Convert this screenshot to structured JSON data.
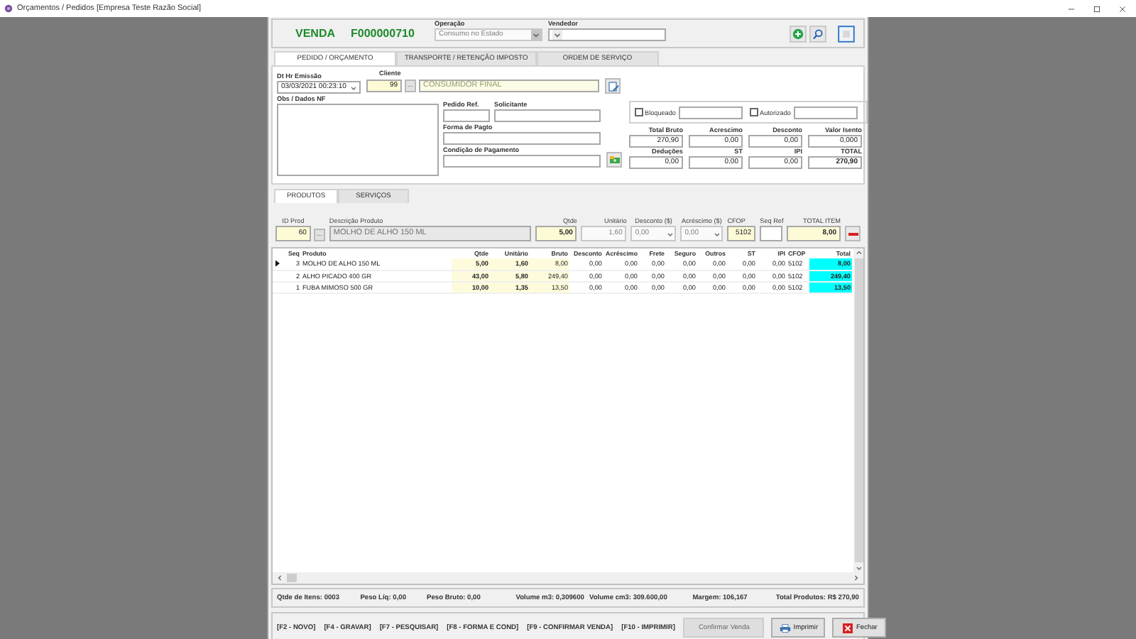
{
  "window": {
    "title": "Orçamentos / Pedidos [Empresa Teste Razão Social]"
  },
  "header": {
    "type": "VENDA",
    "number": "F000000710",
    "operation": {
      "label": "Operação",
      "value": "Consumo no Estado",
      "disabled": true
    },
    "seller": {
      "label": "Vendedor"
    }
  },
  "tabs": [
    {
      "label": "PEDIDO / ORÇAMENTO",
      "selected": true
    },
    {
      "label": "TRANSPORTE / RETENÇÃO IMPOSTO",
      "selected": false
    },
    {
      "label": "ORDEM DE SERVIÇO",
      "selected": false
    }
  ],
  "order": {
    "emission": {
      "label": "Dt Hr Emissão",
      "value": "03/03/2021 00:23:10"
    },
    "customer": {
      "label": "Cliente",
      "id": "99",
      "button": "...",
      "name": "CONSUMIDOR FINAL"
    },
    "notes": {
      "label": "Obs / Dados NF"
    },
    "reference": {
      "label": "Pedido Ref."
    },
    "requester": {
      "label": "Solicitante"
    },
    "payment_form": {
      "label": "Forma de Pagto"
    },
    "payment_terms": {
      "label": "Condição de Pagamento"
    },
    "flags": [
      {
        "label": "Bloqueado",
        "checked": false
      },
      {
        "label": "Autorizado",
        "checked": false
      }
    ],
    "totals": [
      {
        "label": "Total Bruto",
        "value": "270,90",
        "bold": false
      },
      {
        "label": "Acrescimo",
        "value": "0,00",
        "bold": false
      },
      {
        "label": "Desconto",
        "value": "0,00",
        "bold": false
      },
      {
        "label": "Valor Isento",
        "value": "0,000",
        "bold": false
      },
      {
        "label": "Deduções",
        "value": "0,00",
        "bold": false
      },
      {
        "label": "ST",
        "value": "0,00",
        "bold": false
      },
      {
        "label": "IPI",
        "value": "0,00",
        "bold": false
      },
      {
        "label": "TOTAL",
        "value": "270,90",
        "bold": true
      }
    ]
  },
  "product_tabs": [
    {
      "label": "PRODUTOS",
      "selected": true
    },
    {
      "label": "SERVIÇOS",
      "selected": false
    }
  ],
  "entry": [
    {
      "label": "ID Prod",
      "value": "60",
      "kind": "lookup",
      "button": "...",
      "highlighted": true,
      "disabled": false
    },
    {
      "label": "Descrição Produto",
      "value": "MOLHO DE ALHO 150 ML",
      "kind": "text",
      "highlighted": false,
      "disabled": true
    },
    {
      "label": "Qtde",
      "value": "5,00",
      "kind": "amount",
      "highlighted": true,
      "disabled": false
    },
    {
      "label": "Unitário",
      "value": "1,60",
      "kind": "number",
      "highlighted": false,
      "disabled": true
    },
    {
      "label": "Desconto ($)",
      "value": "0,00",
      "kind": "dropdown",
      "highlighted": false,
      "disabled": true
    },
    {
      "label": "Acréscimo ($)",
      "value": "0,00",
      "kind": "dropdown",
      "highlighted": false,
      "disabled": true
    },
    {
      "label": "CFOP",
      "value": "5102",
      "kind": "number",
      "highlighted": true,
      "disabled": false
    },
    {
      "label": "Seq Ref",
      "kind": "number",
      "highlighted": false,
      "disabled": false
    },
    {
      "label": "TOTAL ITEM",
      "value": "8,00",
      "kind": "amount",
      "highlighted": true,
      "disabled": false
    }
  ],
  "grid": {
    "columns": [
      {
        "label": "Seq",
        "kind": "number",
        "bold": false
      },
      {
        "label": "Produto",
        "kind": "text",
        "bold": false
      },
      {
        "label": "Qtde",
        "kind": "number",
        "bold": true,
        "color": "#fdfbdc"
      },
      {
        "label": "Unitário",
        "kind": "number",
        "bold": true,
        "color": "#fdfbdc"
      },
      {
        "label": "Bruto",
        "kind": "number",
        "bold": false,
        "color": "#fdfbdc"
      },
      {
        "label": "Desconto",
        "kind": "number",
        "bold": false
      },
      {
        "label": "Acréscimo",
        "kind": "number",
        "bold": false
      },
      {
        "label": "Frete",
        "kind": "number",
        "bold": false
      },
      {
        "label": "Seguro",
        "kind": "number",
        "bold": false
      },
      {
        "label": "Outros",
        "kind": "number",
        "bold": false
      },
      {
        "label": "ST",
        "kind": "number",
        "bold": false
      },
      {
        "label": "IPI",
        "kind": "number",
        "bold": false
      },
      {
        "label": "CFOP",
        "kind": "text",
        "bold": false
      },
      {
        "label": "Total",
        "kind": "number",
        "bold": true,
        "color": "#00ffff"
      }
    ],
    "rows": [
      {
        "current": true,
        "cells": [
          "3",
          "MOLHO DE ALHO 150 ML",
          "5,00",
          "1,60",
          "8,00",
          "0,00",
          "0,00",
          "0,00",
          "0,00",
          "0,00",
          "0,00",
          "0,00",
          "5102",
          "8,00"
        ]
      },
      {
        "current": false,
        "cells": [
          "2",
          "ALHO PICADO 400 GR",
          "43,00",
          "5,80",
          "249,40",
          "0,00",
          "0,00",
          "0,00",
          "0,00",
          "0,00",
          "0,00",
          "0,00",
          "5102",
          "249,40"
        ]
      },
      {
        "current": false,
        "cells": [
          "1",
          "FUBA MIMOSO 500 GR",
          "10,00",
          "1,35",
          "13,50",
          "0,00",
          "0,00",
          "0,00",
          "0,00",
          "0,00",
          "0,00",
          "0,00",
          "5102",
          "13,50"
        ]
      }
    ]
  },
  "summary": [
    "Qtde de Itens: 0003",
    "Peso Líq: 0,00",
    "Peso Bruto: 0,00",
    "Volume m3: 0,309600",
    "Volume cm3: 309.600,00",
    "Margem: 106,167",
    "Total Produtos: R$ 270,90"
  ],
  "shortcuts": [
    "[F2 - NOVO]",
    "[F4 - GRAVAR]",
    "[F7 - PESQUISAR]",
    "[F8 - FORMA E COND]",
    "[F9 - CONFIRMAR VENDA]",
    "[F10 - IMPRIMIR]"
  ],
  "buttons": [
    {
      "label": "Confirmar Venda",
      "kind": "confirm",
      "disabled": true
    },
    {
      "label": "Imprimir",
      "kind": "print",
      "disabled": false
    },
    {
      "label": "Fechar",
      "kind": "close",
      "disabled": false
    }
  ]
}
